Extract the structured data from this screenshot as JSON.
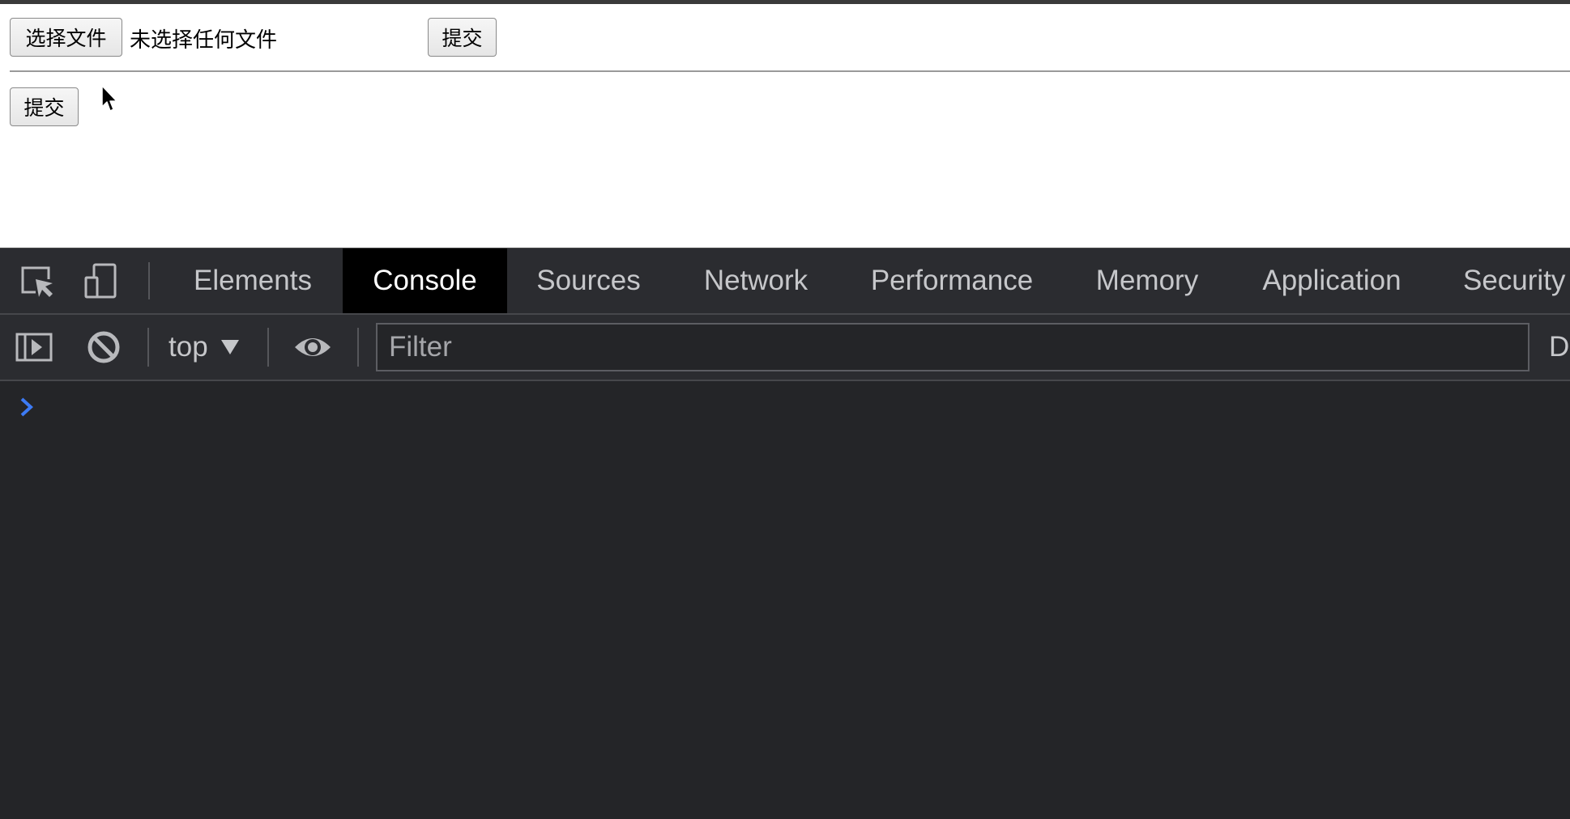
{
  "webpage": {
    "file_input": {
      "button_label": "选择文件",
      "status_text": "未选择任何文件"
    },
    "submit_top_label": "提交",
    "submit_second_label": "提交"
  },
  "devtools": {
    "tabs": [
      {
        "label": "Elements",
        "active": false
      },
      {
        "label": "Console",
        "active": true
      },
      {
        "label": "Sources",
        "active": false
      },
      {
        "label": "Network",
        "active": false
      },
      {
        "label": "Performance",
        "active": false
      },
      {
        "label": "Memory",
        "active": false
      },
      {
        "label": "Application",
        "active": false
      },
      {
        "label": "Security",
        "active": false
      }
    ],
    "console_toolbar": {
      "context": "top",
      "filter_placeholder": "Filter",
      "levels_partial": "D"
    },
    "colors": {
      "panel_bg": "#242528",
      "toolbar_bg": "#2b2c30",
      "active_tab_bg": "#000000",
      "prompt_color": "#3d7bf5"
    },
    "icons": [
      "inspect-element-icon",
      "device-toolbar-icon",
      "console-sidebar-icon",
      "clear-console-icon",
      "chevron-down-icon",
      "live-expression-eye-icon",
      "console-prompt-chevron-icon"
    ]
  }
}
